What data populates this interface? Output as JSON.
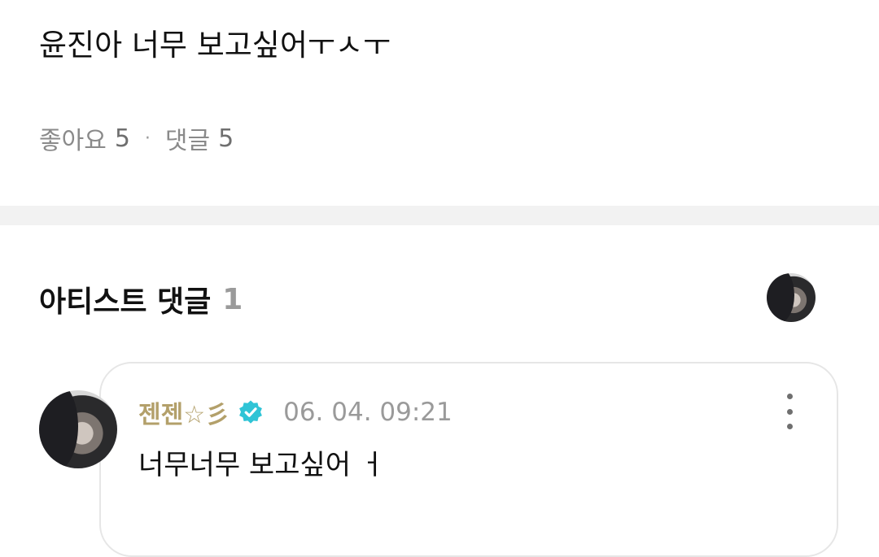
{
  "post": {
    "body_text": "윤진아 너무 보고싶어ㅜㅅㅜ",
    "likes_label": "좋아요",
    "likes_count": "5",
    "separator": "·",
    "comments_label": "댓글",
    "comments_count": "5"
  },
  "artist_comments": {
    "title": "아티스트 댓글",
    "count": "1",
    "comments": [
      {
        "author": "젠젠☆彡",
        "verified": true,
        "timestamp": "06. 04. 09:21",
        "text": "너무너무 보고싶어 ㅓ"
      }
    ]
  },
  "icons": {
    "verified": "verified-badge-icon",
    "more": "more-vertical-icon",
    "avatar": "avatar-image"
  },
  "colors": {
    "author_name": "#b3a06a",
    "verified_badge": "#2fc4d6",
    "muted_text": "#8a8a8a",
    "divider": "#f2f2f2"
  }
}
